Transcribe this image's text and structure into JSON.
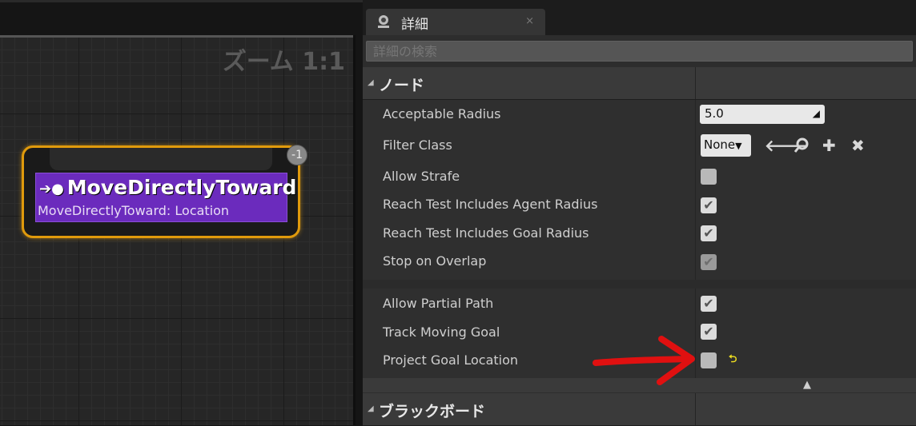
{
  "graph": {
    "zoom_label": "ズーム 1:1"
  },
  "node": {
    "title": "MoveDirectlyToward",
    "subtitle": "MoveDirectlyToward: Location",
    "badge": "-1"
  },
  "details": {
    "tab_label": "詳細",
    "tab_close": "×",
    "search_placeholder": "詳細の検索",
    "categories": {
      "node": "ノード",
      "blackboard": "ブラックボード"
    },
    "properties": {
      "acceptable_radius": {
        "label": "Acceptable Radius",
        "value": "5.0"
      },
      "filter_class": {
        "label": "Filter Class",
        "value": "None"
      },
      "allow_strafe": {
        "label": "Allow Strafe",
        "checked": false
      },
      "reach_agent": {
        "label": "Reach Test Includes Agent Radius",
        "checked": true
      },
      "reach_goal": {
        "label": "Reach Test Includes Goal Radius",
        "checked": true
      },
      "stop_overlap": {
        "label": "Stop on Overlap",
        "checked": true
      },
      "allow_partial": {
        "label": "Allow Partial Path",
        "checked": true
      },
      "track_goal": {
        "label": "Track Moving Goal",
        "checked": true
      },
      "project_goal": {
        "label": "Project Goal Location",
        "checked": false
      }
    },
    "check_glyph": "✔",
    "dropdown_arrow": "▼",
    "collapse_arrow": "▲",
    "icons": [
      "arrow-left-icon",
      "search-icon",
      "plus-icon",
      "close-icon",
      "reset-icon"
    ],
    "colors": {
      "node_border": "#e09a0c",
      "node_body": "#6b2bbd",
      "annotation_arrow": "#e01010"
    }
  }
}
